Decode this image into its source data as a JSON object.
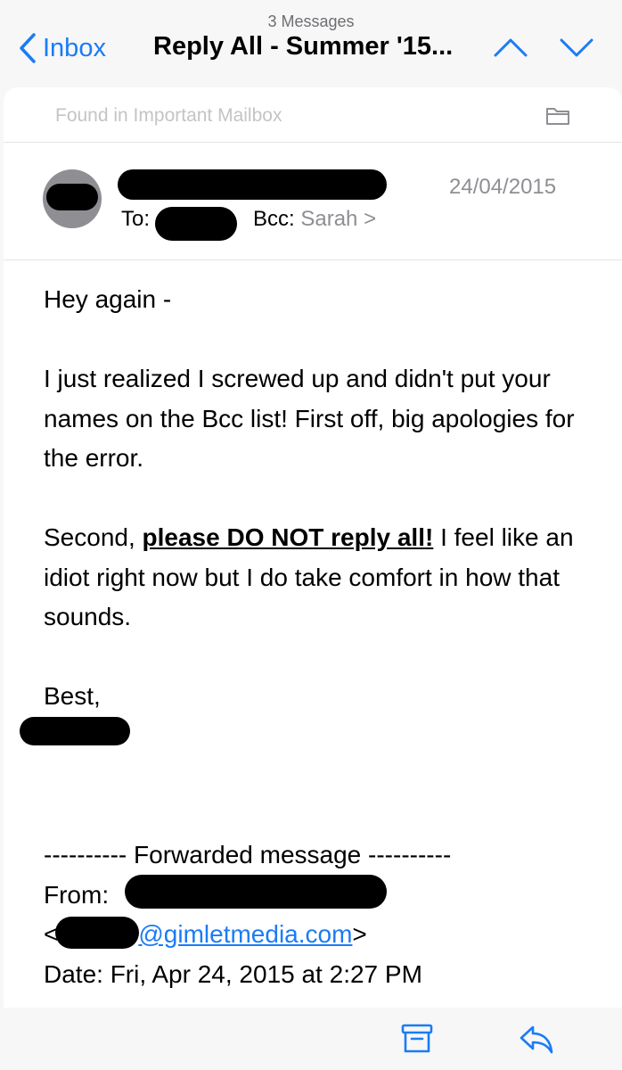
{
  "nav": {
    "message_count": "3 Messages",
    "back_label": "Inbox",
    "title": "Reply All - Summer '15..."
  },
  "banner": {
    "text": "Found in Important Mailbox"
  },
  "header": {
    "date": "24/04/2015",
    "to_label": "To:",
    "bcc_label": "Bcc:",
    "bcc_name": "Sarah",
    "bcc_chevron": ">"
  },
  "body": {
    "greeting": "Hey again -",
    "p1": "I just realized I screwed up and didn't put your names on the Bcc list! First off, big apologies for the error.",
    "p2_prefix": "Second, ",
    "p2_emphasis": "please DO NOT reply all!",
    "p2_suffix": " I feel like an idiot right now but I do take comfort in how that sounds.",
    "signoff": "Best,",
    "forward_header": "---------- Forwarded message ----------",
    "from_label": "From:",
    "email_open": "<",
    "email_domain": "@gimletmedia.com",
    "email_close": ">",
    "date_line": "Date: Fri, Apr 24, 2015 at 2:27 PM"
  },
  "colors": {
    "accent": "#1a7cf5",
    "secondary_text": "#8e8e93",
    "banner_text": "#c4c4c6"
  },
  "icons": {
    "back": "chevron-left-icon",
    "prev": "chevron-up-icon",
    "next": "chevron-down-icon",
    "folder": "folder-icon",
    "archive": "archive-icon",
    "reply": "reply-icon"
  }
}
